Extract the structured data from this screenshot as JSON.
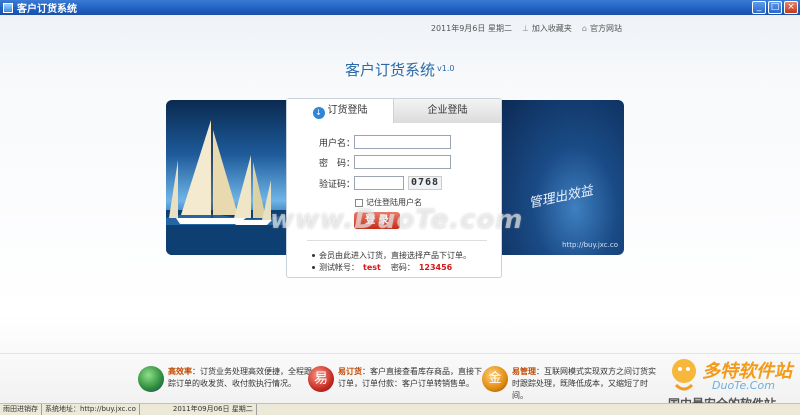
{
  "window": {
    "title": "客户订货系统"
  },
  "topbar": {
    "date": "2011年9月6日  星期二",
    "favorite": "加入收藏夹",
    "official": "官方网站"
  },
  "system": {
    "title": "客户订货系统",
    "version": "v1.0"
  },
  "tabs": {
    "active": "订货登陆",
    "inactive": "企业登陆"
  },
  "form": {
    "username_label": "用户名：",
    "password_label": "密　码：",
    "captcha_label": "验证码：",
    "captcha_value": "0768",
    "remember_label": "记住登陆用户名",
    "login_button": "登 录"
  },
  "notes": {
    "note1": "会员由此进入订货，直接选择产品下订单。",
    "test_account_label": "测试帐号：",
    "test_account": "test",
    "password_label": "密码：",
    "password": "123456"
  },
  "banner": {
    "slogan": "管理出效益",
    "url": "http://buy.jxc.co"
  },
  "watermark": "www.DuoTe.com",
  "features": [
    {
      "title": "高效率",
      "text": "订货业务处理高效便捷，全程跟踪订单的收发货、收付款执行情况。"
    },
    {
      "title": "易订货",
      "text": "客户直接查看库存商品，直接下订单，订单付款：客户订单转销售单。"
    },
    {
      "title": "易管理",
      "text": "互联网模式实现双方之间订货实时跟踪处理，既降低成本，又缩短了时间。"
    }
  ],
  "site_logo": {
    "cn": "多特软件站",
    "en": "DuoTe.Com",
    "sub": "国内最安全的软件站"
  },
  "statusbar": [
    "雨田进销存",
    "系统地址：http://buy.jxc.co",
    "2011年09月06日  星期二"
  ]
}
